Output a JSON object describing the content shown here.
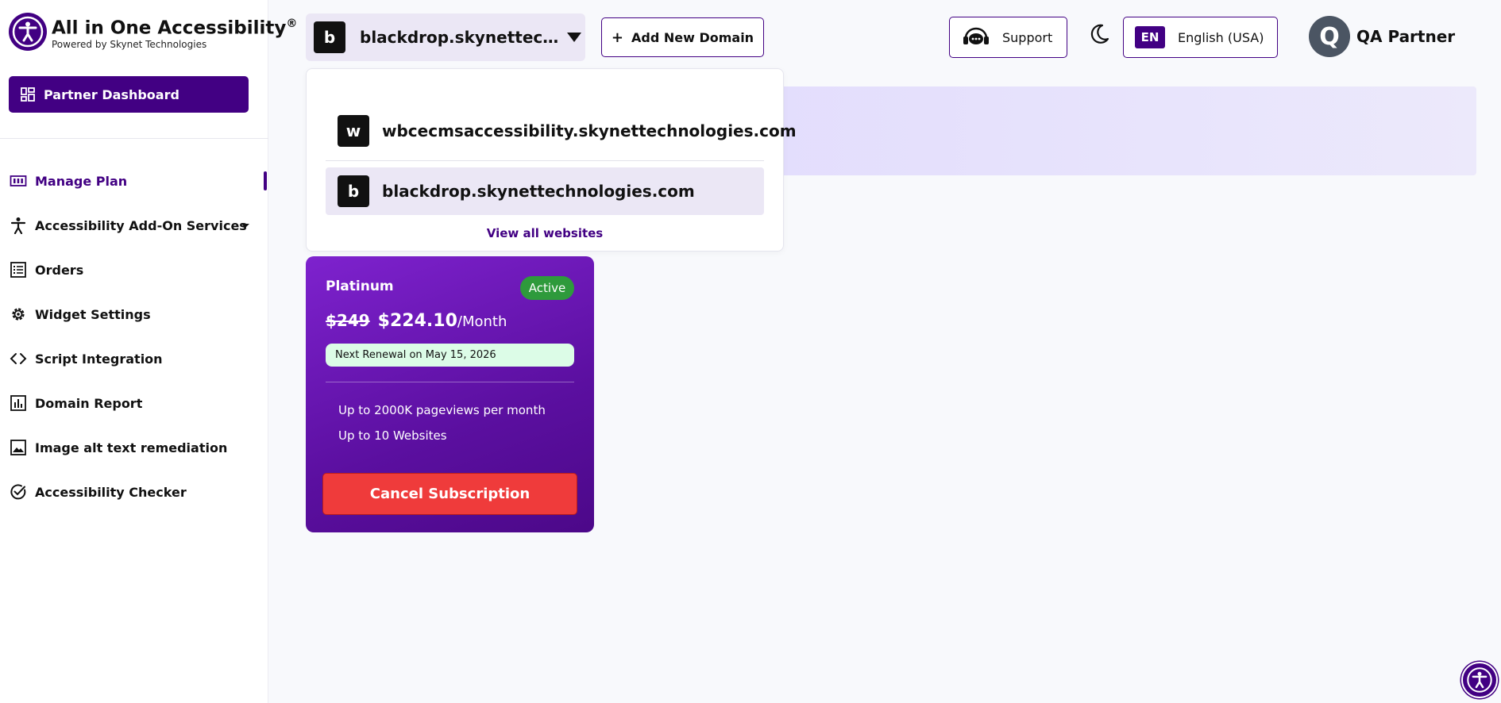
{
  "brand": {
    "title": "All in One Accessibility",
    "reg": "®",
    "subtitle": "Powered by Skynet Technologies"
  },
  "sidebar": {
    "partner_dashboard": "Partner Dashboard",
    "items": [
      {
        "label": "Manage Plan",
        "icon": "plan-icon",
        "active": true
      },
      {
        "label": "Accessibility Add-On Services",
        "icon": "person-icon",
        "has_submenu": true
      },
      {
        "label": "Orders",
        "icon": "list-icon"
      },
      {
        "label": "Widget Settings",
        "icon": "gear-icon"
      },
      {
        "label": "Script Integration",
        "icon": "code-icon"
      },
      {
        "label": "Domain Report",
        "icon": "bar-chart-icon"
      },
      {
        "label": "Image alt text remediation",
        "icon": "image-icon"
      },
      {
        "label": "Accessibility Checker",
        "icon": "check-circle-icon"
      }
    ]
  },
  "header": {
    "selected_domain": {
      "letter": "b",
      "name": "blackdrop.skynettechnologies.com"
    },
    "add_domain": "Add New Domain",
    "support": "Support",
    "lang_code": "EN",
    "lang_name": "English (USA)",
    "user_initial": "Q",
    "user_name": "QA Partner"
  },
  "dropdown": {
    "items": [
      {
        "letter": "w",
        "name": "wbcecmsaccessibility.skynettechnologies.com"
      },
      {
        "letter": "b",
        "name": "blackdrop.skynettechnologies.com",
        "selected": true
      }
    ],
    "view_all": "View all websites"
  },
  "plan": {
    "name": "Platinum",
    "status": "Active",
    "old_price": "$249",
    "new_price": "$224.10",
    "period": "/Month",
    "renewal": "Next Renewal on May 15, 2026",
    "features": [
      "Up to 2000K pageviews per month",
      "Up to 10 Websites"
    ],
    "cancel": "Cancel Subscription"
  },
  "colors": {
    "brand": "#420083",
    "active_badge": "#2e9a3c",
    "cancel": "#ef3b3b",
    "renewal_bg": "#dcfce7"
  }
}
